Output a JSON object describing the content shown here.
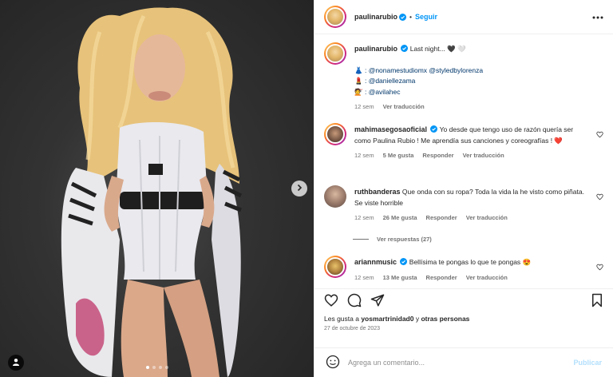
{
  "header": {
    "username": "paulinarubio",
    "separator": "•",
    "follow_label": "Seguir"
  },
  "caption": {
    "username": "paulinarubio",
    "text": "Last night... 🖤 🤍",
    "credits": [
      {
        "emoji": "👗",
        "text": ": @nonamestudiomx @styledbylorenza"
      },
      {
        "emoji": "💄",
        "text": ": @daniellezama"
      },
      {
        "emoji": "💇",
        "text": ": @avilahec"
      }
    ],
    "time": "12 sem",
    "translate": "Ver traducción"
  },
  "comments": [
    {
      "username": "mahimasegosaoficial",
      "text": "Yo desde que tengo uso de razón quería ser como Paulina Rubio ! Me aprendía sus canciones y coreografías ! ❤️",
      "time": "12 sem",
      "likes": "5 Me gusta",
      "reply": "Responder",
      "translate": "Ver traducción"
    },
    {
      "username": "ruthbanderas",
      "text": "Que onda con su ropa? Toda la vida la he visto como piñata. Se viste horrible",
      "time": "12 sem",
      "likes": "26 Me gusta",
      "reply": "Responder",
      "translate": "Ver traducción",
      "view_replies": "Ver respuestas (27)"
    },
    {
      "username": "ariannmusic",
      "text": "Bellísima te pongas lo que te pongas 😍",
      "time": "12 sem",
      "likes": "13 Me gusta",
      "reply": "Responder",
      "translate": "Ver traducción"
    }
  ],
  "likes": {
    "prefix": "Les gusta a",
    "user": "yosmartrinidad0",
    "middle": "y",
    "others": "otras personas"
  },
  "date": "27 de octubre de 2023",
  "comment_box": {
    "placeholder": "Agrega un comentario...",
    "publish_label": "Publicar"
  },
  "colors": {
    "accent": "#0095f6",
    "text": "#262626",
    "muted": "#737373",
    "heart": "#ed4956"
  },
  "icons": {
    "more": "more-horizontal-icon",
    "like": "heart-icon",
    "comment": "comment-icon",
    "share": "share-icon",
    "save": "bookmark-icon",
    "emoji": "emoji-icon",
    "next": "chevron-right-icon",
    "tag": "user-tag-icon"
  }
}
